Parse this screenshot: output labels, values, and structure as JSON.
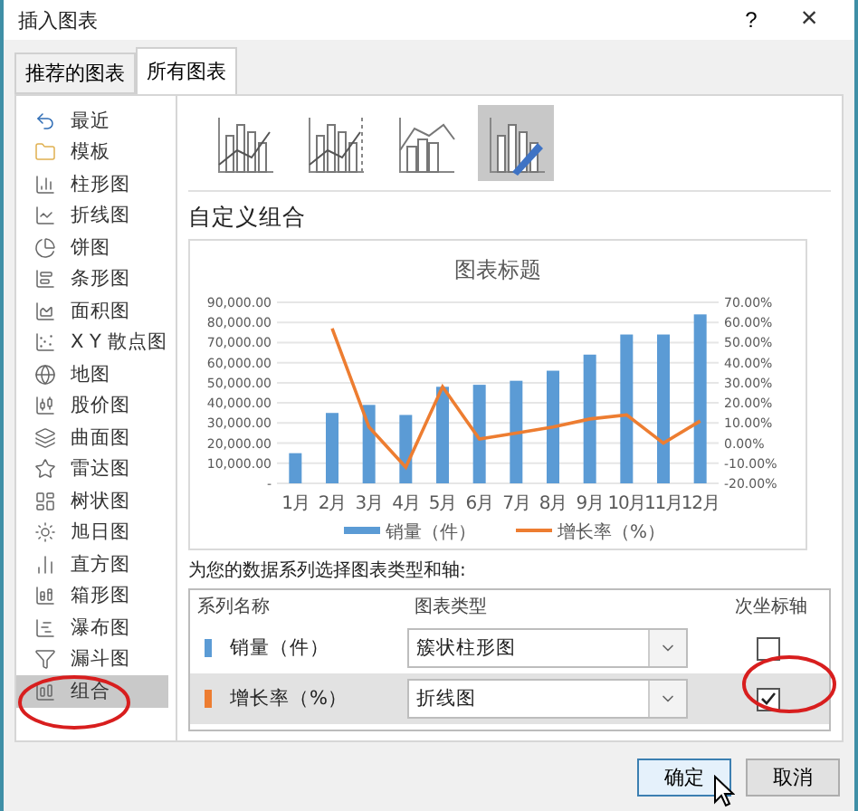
{
  "window": {
    "title": "插入图表",
    "help": "?",
    "close": "×"
  },
  "tabs": [
    {
      "label": "推荐的图表",
      "selected": false
    },
    {
      "label": "所有图表",
      "selected": true
    }
  ],
  "sidebar": {
    "items": [
      {
        "label": "最近",
        "selected": false
      },
      {
        "label": "模板",
        "selected": false
      },
      {
        "label": "柱形图",
        "selected": false
      },
      {
        "label": "折线图",
        "selected": false
      },
      {
        "label": "饼图",
        "selected": false
      },
      {
        "label": "条形图",
        "selected": false
      },
      {
        "label": "面积图",
        "selected": false
      },
      {
        "label": "X Y 散点图",
        "selected": false
      },
      {
        "label": "地图",
        "selected": false
      },
      {
        "label": "股价图",
        "selected": false
      },
      {
        "label": "曲面图",
        "selected": false
      },
      {
        "label": "雷达图",
        "selected": false
      },
      {
        "label": "树状图",
        "selected": false
      },
      {
        "label": "旭日图",
        "selected": false
      },
      {
        "label": "直方图",
        "selected": false
      },
      {
        "label": "箱形图",
        "selected": false
      },
      {
        "label": "瀑布图",
        "selected": false
      },
      {
        "label": "漏斗图",
        "selected": false
      },
      {
        "label": "组合",
        "selected": true
      }
    ]
  },
  "subtypes": [
    {
      "selected": false
    },
    {
      "selected": false
    },
    {
      "selected": false
    },
    {
      "selected": true
    }
  ],
  "heading": "自定义组合",
  "preview": {
    "chart_data": {
      "type": "bar",
      "title": "图表标题",
      "categories": [
        "1月",
        "2月",
        "3月",
        "4月",
        "5月",
        "6月",
        "7月",
        "8月",
        "9月",
        "10月",
        "11月",
        "12月"
      ],
      "series": [
        {
          "name": "销量（件）",
          "color": "#5b9bd5",
          "values": [
            15000,
            35000,
            39000,
            34000,
            48000,
            49000,
            51000,
            56000,
            64000,
            74000,
            74000,
            84000
          ]
        },
        {
          "name": "增长率（%）",
          "color": "#ed7d31",
          "type": "line",
          "axis": "y2",
          "values": [
            null,
            0.57,
            0.08,
            -0.12,
            0.28,
            0.02,
            0.05,
            0.08,
            0.12,
            0.14,
            0.0,
            0.11
          ]
        }
      ],
      "ylim": [
        0,
        90000
      ],
      "y2lim": [
        -0.2,
        0.7
      ],
      "grid": true,
      "legend": "bottom",
      "yticks": [
        {
          "value": 0,
          "label": "-"
        },
        {
          "value": 10000,
          "label": "10,000.00"
        },
        {
          "value": 20000,
          "label": "20,000.00"
        },
        {
          "value": 30000,
          "label": "30,000.00"
        },
        {
          "value": 40000,
          "label": "40,000.00"
        },
        {
          "value": 50000,
          "label": "50,000.00"
        },
        {
          "value": 60000,
          "label": "60,000.00"
        },
        {
          "value": 70000,
          "label": "70,000.00"
        },
        {
          "value": 80000,
          "label": "80,000.00"
        },
        {
          "value": 90000,
          "label": "90,000.00"
        }
      ],
      "y2ticks": [
        {
          "value": -0.2,
          "label": "-20.00%"
        },
        {
          "value": -0.1,
          "label": "-10.00%"
        },
        {
          "value": 0,
          "label": "0.00%"
        },
        {
          "value": 0.1,
          "label": "10.00%"
        },
        {
          "value": 0.2,
          "label": "20.00%"
        },
        {
          "value": 0.3,
          "label": "30.00%"
        },
        {
          "value": 0.4,
          "label": "40.00%"
        },
        {
          "value": 0.5,
          "label": "50.00%"
        },
        {
          "value": 0.6,
          "label": "60.00%"
        },
        {
          "value": 0.7,
          "label": "70.00%"
        }
      ]
    }
  },
  "series_prompt": "为您的数据系列选择图表类型和轴:",
  "series_table": {
    "columns": [
      "系列名称",
      "图表类型",
      "次坐标轴"
    ],
    "rows": [
      {
        "name": "销量（件）",
        "color": "#5b9bd5",
        "chart_type": "簇状柱形图",
        "secondary_axis": false,
        "selected": false
      },
      {
        "name": "增长率（%）",
        "color": "#ed7d31",
        "chart_type": "折线图",
        "secondary_axis": true,
        "selected": true
      }
    ]
  },
  "buttons": [
    {
      "label": "确定",
      "default": true
    },
    {
      "label": "取消",
      "default": false
    }
  ]
}
